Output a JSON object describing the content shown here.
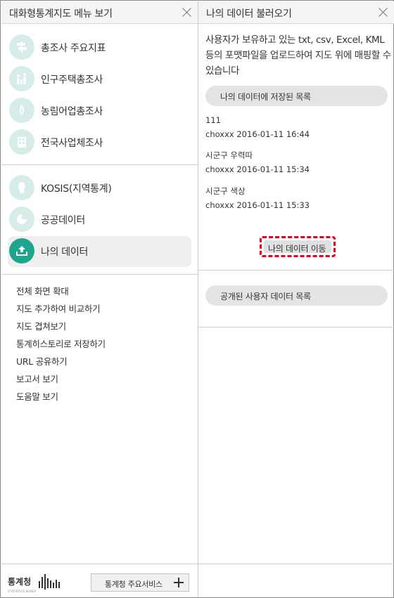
{
  "left_panel": {
    "title": "대화형통계지도 메뉴 보기",
    "menu_group_1": [
      {
        "label": "총조사 주요지표",
        "icon": "signpost-icon"
      },
      {
        "label": "인구주택총조사",
        "icon": "people-icon"
      },
      {
        "label": "농림어업총조사",
        "icon": "agriculture-icon"
      },
      {
        "label": "전국사업체조사",
        "icon": "building-icon"
      }
    ],
    "menu_group_2": [
      {
        "label": "KOSIS(지역통계)",
        "icon": "korea-map-icon"
      },
      {
        "label": "공공데이터",
        "icon": "pie-chart-icon"
      },
      {
        "label": "나의 데이터",
        "icon": "upload-icon",
        "active": true
      }
    ],
    "links": [
      "전체 화면 확대",
      "지도 추가하여 비교하기",
      "지도 겹쳐보기",
      "통계히스토리로 저장하기",
      "URL 공유하기",
      "보고서 보기",
      "도움말 보기"
    ],
    "footer": {
      "logo_text": "통계청",
      "logo_sub": "STATISTICS KOREA",
      "service_button": "통계청 주요서비스"
    }
  },
  "right_panel": {
    "title": "나의 데이터 불러오기",
    "description": "사용자가 보유하고 있는 txt, csv, Excel, KML 등의 포맷파일을 업로드하여 지도 위에 매핑할 수 있습니다",
    "saved_list_label": "나의 데이터에 저장된 목록",
    "saved_items": [
      {
        "name": "111",
        "meta": "choxxx 2016-01-11 16:44"
      },
      {
        "name": "시군구 우력따",
        "meta": "choxxx 2016-01-11 15:34"
      },
      {
        "name": "시군구 색상",
        "meta": "choxxx 2016-01-11 15:33"
      }
    ],
    "move_button": "나의 데이터 이동",
    "public_list_label": "공개된 사용자 데이터 목록"
  },
  "colors": {
    "accent": "#1da58e",
    "icon_bg": "#d6ece8",
    "highlight_border": "#e8001c"
  }
}
